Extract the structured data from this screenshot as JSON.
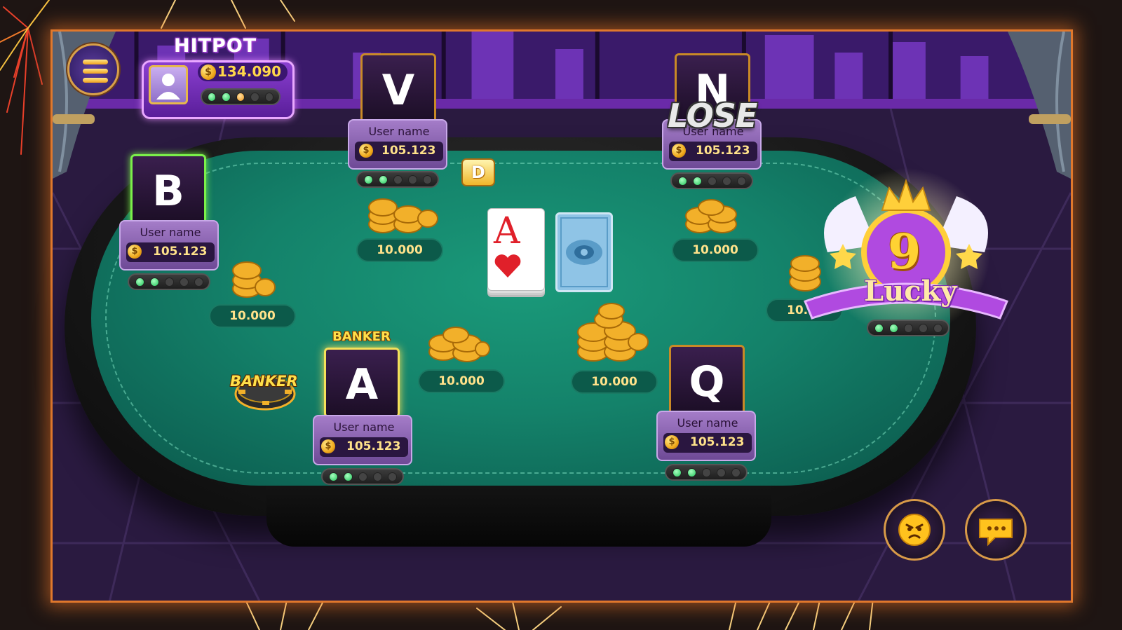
{
  "menu": {
    "icon": "hamburger-menu-icon"
  },
  "hitpot": {
    "title": "HITPOT",
    "amount": "134.090",
    "coin_symbol": "$",
    "level_dots": [
      "green",
      "green",
      "orange",
      "off",
      "off"
    ]
  },
  "dealer_button": {
    "label": "D"
  },
  "center_cards": {
    "face_up": {
      "rank": "A",
      "suit": "hearts"
    },
    "face_down": true
  },
  "players": [
    {
      "id": "V",
      "username": "User name",
      "balance": "105.123",
      "bet": "10.000",
      "dots": [
        "green",
        "green",
        "off",
        "off",
        "off"
      ]
    },
    {
      "id": "N",
      "username": "User name",
      "balance": "105.123",
      "bet": "10.000",
      "status": "LOSE",
      "dots": [
        "green",
        "green",
        "off",
        "off",
        "off"
      ]
    },
    {
      "id": "B",
      "username": "User name",
      "balance": "105.123",
      "bet": "10.000",
      "active": true,
      "dots": [
        "green",
        "green",
        "off",
        "off",
        "off"
      ]
    },
    {
      "id": "A",
      "username": "User name",
      "balance": "105.123",
      "bet": "10.000",
      "role": "BANKER",
      "dots": [
        "green",
        "green",
        "off",
        "off",
        "off"
      ]
    },
    {
      "id": "Q",
      "username": "User name",
      "balance": "105.123",
      "bet": "10.000",
      "dots": [
        "green",
        "green",
        "off",
        "off",
        "off"
      ]
    }
  ],
  "center_bet": "10.000",
  "partial_bet": "10.0",
  "banker_chip": {
    "label": "BANKER"
  },
  "lucky_badge": {
    "number": "9",
    "text": "Lucky",
    "dots": [
      "green",
      "green",
      "off",
      "off",
      "off"
    ]
  },
  "buttons": {
    "emoji": "emoji-face-icon",
    "chat": "chat-bubble-icon"
  },
  "colors": {
    "felt": "#14826a",
    "frame_glow": "#e0782c",
    "gold": "#ffd84a",
    "active_green": "#7bf04a"
  }
}
